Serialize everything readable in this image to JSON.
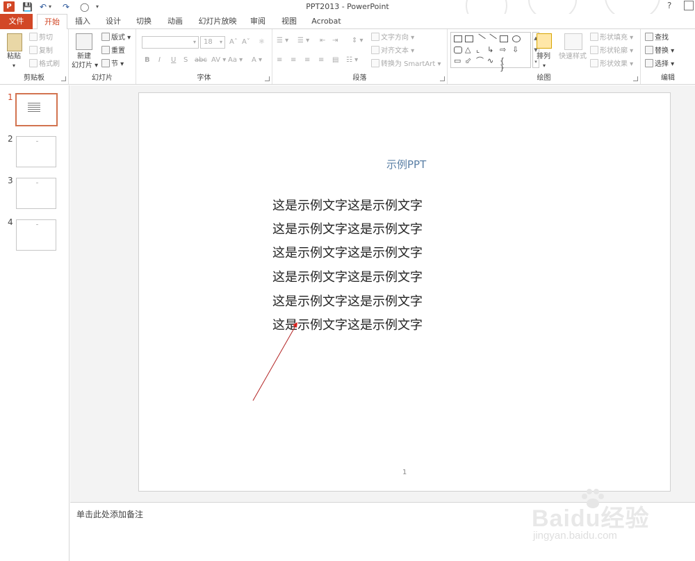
{
  "window": {
    "title": "PPT2013 - PowerPoint",
    "help": "?"
  },
  "tabs": {
    "file": "文件",
    "home": "开始",
    "insert": "插入",
    "design": "设计",
    "transitions": "切换",
    "animations": "动画",
    "slideshow": "幻灯片放映",
    "review": "审阅",
    "view": "视图",
    "acrobat": "Acrobat"
  },
  "ribbon": {
    "clipboard": {
      "label": "剪贴板",
      "paste": "粘贴",
      "cut": "剪切",
      "copy": "复制",
      "format_painter": "格式刷"
    },
    "slides": {
      "label": "幻灯片",
      "new_slide_1": "新建",
      "new_slide_2": "幻灯片",
      "layout": "版式",
      "reset": "重置",
      "section": "节"
    },
    "font": {
      "label": "字体",
      "size": "18"
    },
    "paragraph": {
      "label": "段落",
      "text_direction": "文字方向",
      "align_text": "对齐文本",
      "smartart": "转换为 SmartArt"
    },
    "drawing": {
      "label": "绘图",
      "arrange": "排列",
      "quick_styles": "快速样式",
      "shape_fill": "形状填充",
      "shape_outline": "形状轮廓",
      "shape_effects": "形状效果"
    },
    "editing": {
      "label": "编辑",
      "find": "查找",
      "replace": "替换",
      "select": "选择"
    }
  },
  "slide_pane": {
    "numbers": [
      "1",
      "2",
      "3",
      "4"
    ],
    "selected": "1"
  },
  "slide": {
    "title": "示例PPT",
    "lines": [
      "这是示例文字这是示例文字",
      "这是示例文字这是示例文字",
      "这是示例文字这是示例文字",
      "这是示例文字这是示例文字",
      "这是示例文字这是示例文字",
      "这是示例文字这是示例文字"
    ],
    "page_number": "1"
  },
  "notes": {
    "placeholder": "单击此处添加备注"
  },
  "watermark": {
    "logo": "Baidu经验",
    "url": "jingyan.baidu.com"
  },
  "colors": {
    "accent": "#d24726",
    "title_text": "#5a7fa5",
    "annotation_arrow": "#b22222"
  }
}
